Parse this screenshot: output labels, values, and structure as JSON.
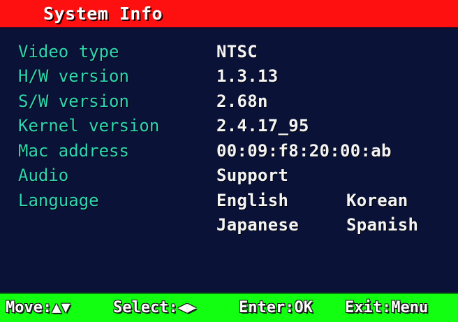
{
  "header": {
    "title": "System Info"
  },
  "info": {
    "rows": [
      {
        "label": "Video type",
        "value": "NTSC"
      },
      {
        "label": "H/W version",
        "value": "1.3.13"
      },
      {
        "label": "S/W version",
        "value": "2.68n"
      },
      {
        "label": "Kernel version",
        "value": "2.4.17_95"
      },
      {
        "label": "Mac address",
        "value": "00:09:f8:20:00:ab"
      },
      {
        "label": "Audio",
        "value": "Support"
      }
    ],
    "language": {
      "label": "Language",
      "options": [
        "English",
        "Korean",
        "Japanese",
        "Spanish"
      ]
    }
  },
  "footer": {
    "move_label": "Move:",
    "move_icon": "▲▼",
    "select_label": "Select:",
    "select_icon": "◀▶",
    "enter_label": "Enter:OK",
    "exit_label": "Exit:Menu"
  },
  "colors": {
    "title_bar": "#ff1010",
    "background": "#0a1238",
    "label_text": "#2fd6b0",
    "value_text": "#f4f4f4",
    "footer_bar": "#12ff12"
  }
}
